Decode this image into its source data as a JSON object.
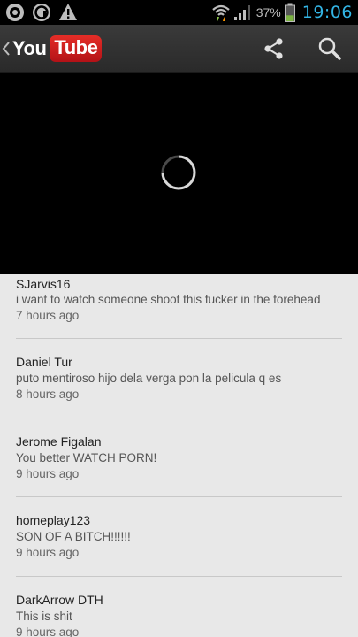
{
  "status_bar": {
    "notification_icons": [
      "target-icon",
      "at-icon",
      "warning-icon"
    ],
    "wifi_icon": "wifi-icon",
    "signal_icon": "signal-icon",
    "battery_percent": "37%",
    "battery_level": 0.37,
    "time": "19:06",
    "time_color": "#33b5e5"
  },
  "action_bar": {
    "logo_you": "You",
    "logo_tube": "Tube",
    "brand_color": "#e52d27",
    "share_icon": "share-icon",
    "search_icon": "search-icon"
  },
  "player": {
    "state": "loading",
    "spinner_icon": "loading-spinner-icon"
  },
  "comments": [
    {
      "author": "SJarvis16",
      "text": "i want to watch someone shoot this fucker in the forehead",
      "time": "7 hours ago"
    },
    {
      "author": "Daniel Tur",
      "text": "puto mentiroso hijo dela verga pon la pelicula q es",
      "time": "8 hours ago"
    },
    {
      "author": "Jerome Figalan",
      "text": "You better WATCH PORN!",
      "time": "9 hours ago"
    },
    {
      "author": "homeplay123",
      "text": "SON OF A BITCH!!!!!!",
      "time": "9 hours ago"
    },
    {
      "author": "DarkArrow DTH",
      "text": "This is shit",
      "time": "9 hours ago"
    }
  ]
}
